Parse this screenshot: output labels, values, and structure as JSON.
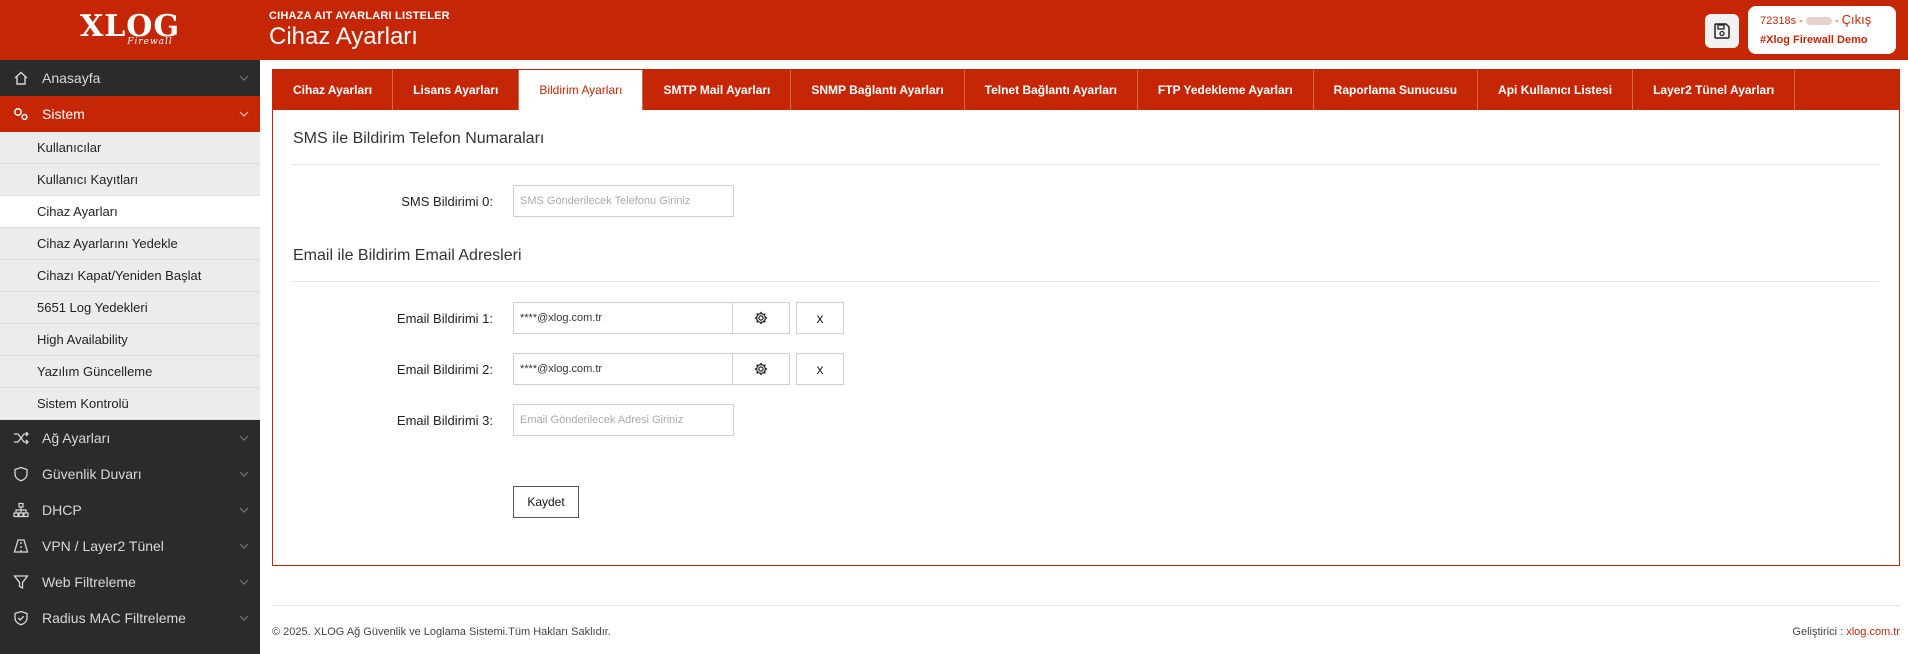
{
  "brand": {
    "logo_text": "XLOG",
    "logo_sub": "Firewall"
  },
  "header": {
    "subtitle": "CIHAZA AIT AYARLARI LISTELER",
    "title": "Cihaz Ayarları",
    "save_icon": "floppy-disk-icon",
    "user_id": "72318s -",
    "user_sep": "-",
    "logout_label": "Çıkış",
    "user_sub": "#Xlog Firewall Demo"
  },
  "sidebar": {
    "items": [
      {
        "label": "Anasayfa",
        "icon": "home-icon"
      },
      {
        "label": "Sistem",
        "icon": "gears-icon",
        "active": true
      },
      {
        "label": "Ağ Ayarları",
        "icon": "shuffle-icon"
      },
      {
        "label": "Güvenlik Duvarı",
        "icon": "shield-icon"
      },
      {
        "label": "DHCP",
        "icon": "sitemap-icon"
      },
      {
        "label": "VPN / Layer2 Tünel",
        "icon": "road-icon"
      },
      {
        "label": "Web Filtreleme",
        "icon": "filter-icon"
      },
      {
        "label": "Radius MAC Filtreleme",
        "icon": "shield-check-icon"
      }
    ],
    "submenu": [
      "Kullanıcılar",
      "Kullanıcı Kayıtları",
      "Cihaz Ayarları",
      "Cihaz Ayarlarını Yedekle",
      "Cihazı Kapat/Yeniden Başlat",
      "5651 Log Yedekleri",
      "High Availability",
      "Yazılım Güncelleme",
      "Sistem Kontrolü"
    ],
    "active_sub": "Cihaz Ayarları"
  },
  "tabs": [
    "Cihaz Ayarları",
    "Lisans Ayarları",
    "Bildirim Ayarları",
    "SMTP Mail Ayarları",
    "SNMP Bağlantı Ayarları",
    "Telnet Bağlantı Ayarları",
    "FTP Yedekleme Ayarları",
    "Raporlama Sunucusu",
    "Api Kullanıcı Listesi",
    "Layer2 Tünel Ayarları"
  ],
  "active_tab": "Bildirim Ayarları",
  "sms_section": {
    "title": "SMS ile Bildirim Telefon Numaraları",
    "fields": [
      {
        "label": "SMS Bildirimi 0:",
        "value": "",
        "placeholder": "SMS Gönderilecek Telefonu Giriniz"
      }
    ]
  },
  "email_section": {
    "title": "Email ile Bildirim Email Adresleri",
    "fields": [
      {
        "label": "Email Bildirimi 1:",
        "value": "****@xlog.com.tr",
        "placeholder": ""
      },
      {
        "label": "Email Bildirimi 2:",
        "value": "****@xlog.com.tr",
        "placeholder": ""
      },
      {
        "label": "Email Bildirimi 3:",
        "value": "",
        "placeholder": "Email Gönderilecek Adresi Giriniz"
      }
    ],
    "settings_icon": "gear-icon",
    "remove_label": "x"
  },
  "submit_label": "Kaydet",
  "footer": {
    "copyright": "© 2025. XLOG Ağ Güvenlik ve Loglama Sistemi.Tüm Hakları Saklıdır.",
    "dev_label": "Geliştirici :",
    "dev_link": "xlog.com.tr"
  },
  "colors": {
    "brand": "#c52706",
    "sidebar_bg": "#2b2b2b",
    "submenu_bg": "#ececec"
  }
}
